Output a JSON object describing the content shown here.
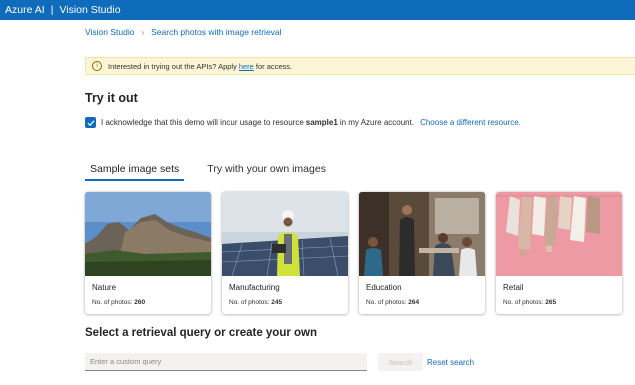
{
  "topbar": {
    "brand": "Azure AI",
    "separator": "|",
    "product": "Vision Studio"
  },
  "breadcrumb": {
    "root": "Vision Studio",
    "current": "Search photos with image retrieval"
  },
  "notice": {
    "text_before": "Interested in trying out the APIs? Apply",
    "link": "here",
    "text_after": "for access."
  },
  "try_it_out": {
    "title": "Try it out",
    "ack_before": "I acknowledge that this demo will incur usage to resource",
    "resource": "sample1",
    "ack_after": "in my Azure account.",
    "change_resource": "Choose a different resource.",
    "checked": true
  },
  "tabs": [
    {
      "label": "Sample image sets",
      "active": true
    },
    {
      "label": "Try with your own images",
      "active": false
    }
  ],
  "image_sets": [
    {
      "name": "Nature",
      "count_label": "No. of photos:",
      "count": "260",
      "thumb": "mountain-landscape"
    },
    {
      "name": "Manufacturing",
      "count_label": "No. of photos:",
      "count": "245",
      "thumb": "worker-solar-panels"
    },
    {
      "name": "Education",
      "count_label": "No. of photos:",
      "count": "264",
      "thumb": "classroom"
    },
    {
      "name": "Retail",
      "count_label": "No. of photos:",
      "count": "265",
      "thumb": "clothing-rack"
    }
  ],
  "query": {
    "title": "Select a retrieval query or create your own",
    "placeholder": "Enter a custom query",
    "search_label": "Search",
    "reset_label": "Reset search"
  },
  "colors": {
    "accent": "#0f6cbd",
    "notice_bg": "#fdf6d6"
  }
}
